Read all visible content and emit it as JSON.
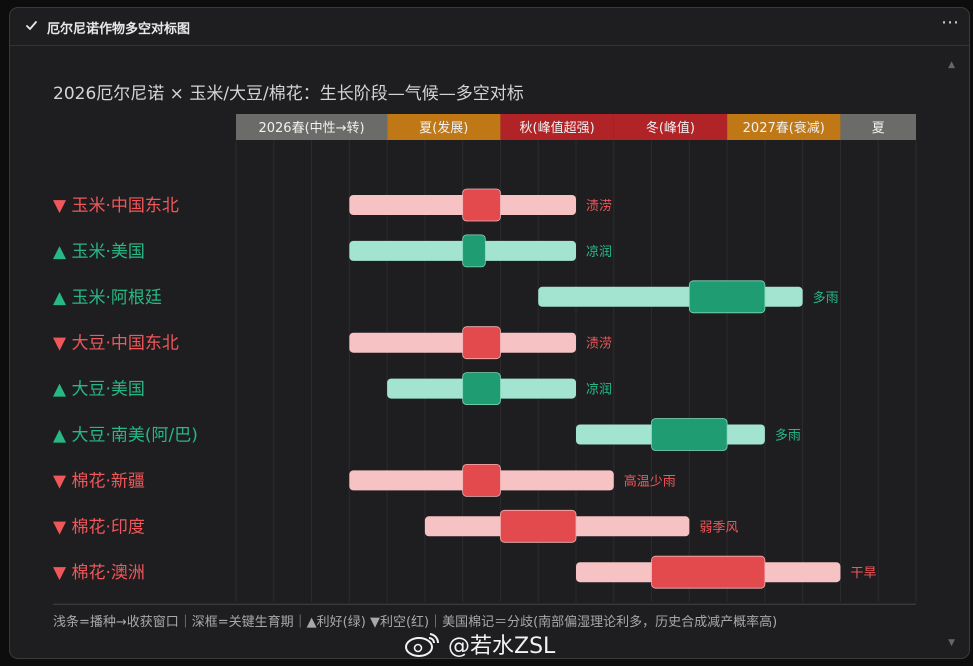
{
  "window": {
    "title": "厄尔尼诺作物多空对标图",
    "check_icon": "check-icon",
    "more_icon": "more-options-icon"
  },
  "watermark": {
    "icon": "weibo-logo-icon",
    "text": "@若水ZSL"
  },
  "colors": {
    "background": "#1e1e20",
    "bear_light": "#f6c2c4",
    "bear_dark": "#e24a4d",
    "bull_light": "#a2e4cf",
    "bull_dark": "#1f9c72",
    "bear_text": "#f0575a",
    "bull_text": "#27b885",
    "phase_neutral": "#6b6b69",
    "phase_develop": "#c07716",
    "phase_peak": "#b02428"
  },
  "chart_data": {
    "type": "gantt",
    "title": "2026厄尔尼诺 × 玉米/大豆/棉花：生长阶段—气候—多空对标",
    "x_unit": "半月",
    "x_range": [
      0,
      18
    ],
    "grid": true,
    "phases": [
      {
        "label": "2026春(中性→转)",
        "start": 0,
        "end": 4,
        "color": "#6b6b69"
      },
      {
        "label": "夏(发展)",
        "start": 4,
        "end": 7,
        "color": "#c07716"
      },
      {
        "label": "秋(峰值超强)",
        "start": 7,
        "end": 10,
        "color": "#b02428"
      },
      {
        "label": "冬(峰值)",
        "start": 10,
        "end": 13,
        "color": "#b02428"
      },
      {
        "label": "2027春(衰减)",
        "start": 13,
        "end": 16,
        "color": "#c07716"
      },
      {
        "label": "夏",
        "start": 16,
        "end": 18,
        "color": "#6b6b69"
      }
    ],
    "rows": [
      {
        "marker": "▼",
        "label": "玉米·中国东北",
        "sentiment": "bearish",
        "window": [
          3,
          9
        ],
        "critical": [
          6,
          7
        ],
        "climate": "渍涝"
      },
      {
        "marker": "▲",
        "label": "玉米·美国",
        "sentiment": "bullish",
        "window": [
          3,
          9
        ],
        "critical": [
          6,
          6.6
        ],
        "climate": "凉润"
      },
      {
        "marker": "▲",
        "label": "玉米·阿根廷",
        "sentiment": "bullish",
        "window": [
          8,
          15
        ],
        "critical": [
          12,
          14
        ],
        "climate": "多雨"
      },
      {
        "marker": "▼",
        "label": "大豆·中国东北",
        "sentiment": "bearish",
        "window": [
          3,
          9
        ],
        "critical": [
          6,
          7
        ],
        "climate": "渍涝"
      },
      {
        "marker": "▲",
        "label": "大豆·美国",
        "sentiment": "bullish",
        "window": [
          4,
          9
        ],
        "critical": [
          6,
          7
        ],
        "climate": "凉润"
      },
      {
        "marker": "▲",
        "label": "大豆·南美(阿/巴)",
        "sentiment": "bullish",
        "window": [
          9,
          14
        ],
        "critical": [
          11,
          13
        ],
        "climate": "多雨"
      },
      {
        "marker": "▼",
        "label": "棉花·新疆",
        "sentiment": "bearish",
        "window": [
          3,
          10
        ],
        "critical": [
          6,
          7
        ],
        "climate": "高温少雨"
      },
      {
        "marker": "▼",
        "label": "棉花·印度",
        "sentiment": "bearish",
        "window": [
          5,
          12
        ],
        "critical": [
          7,
          9
        ],
        "climate": "弱季风"
      },
      {
        "marker": "▼",
        "label": "棉花·澳洲",
        "sentiment": "bearish",
        "window": [
          9,
          16
        ],
        "critical": [
          11,
          14
        ],
        "climate": "干旱"
      }
    ],
    "footnote": "浅条=播种→收获窗口｜深框=关键生育期｜▲利好(绿) ▼利空(红)｜美国棉记＝分歧(南部偏湿理论利多，历史合成减产概率高)"
  }
}
